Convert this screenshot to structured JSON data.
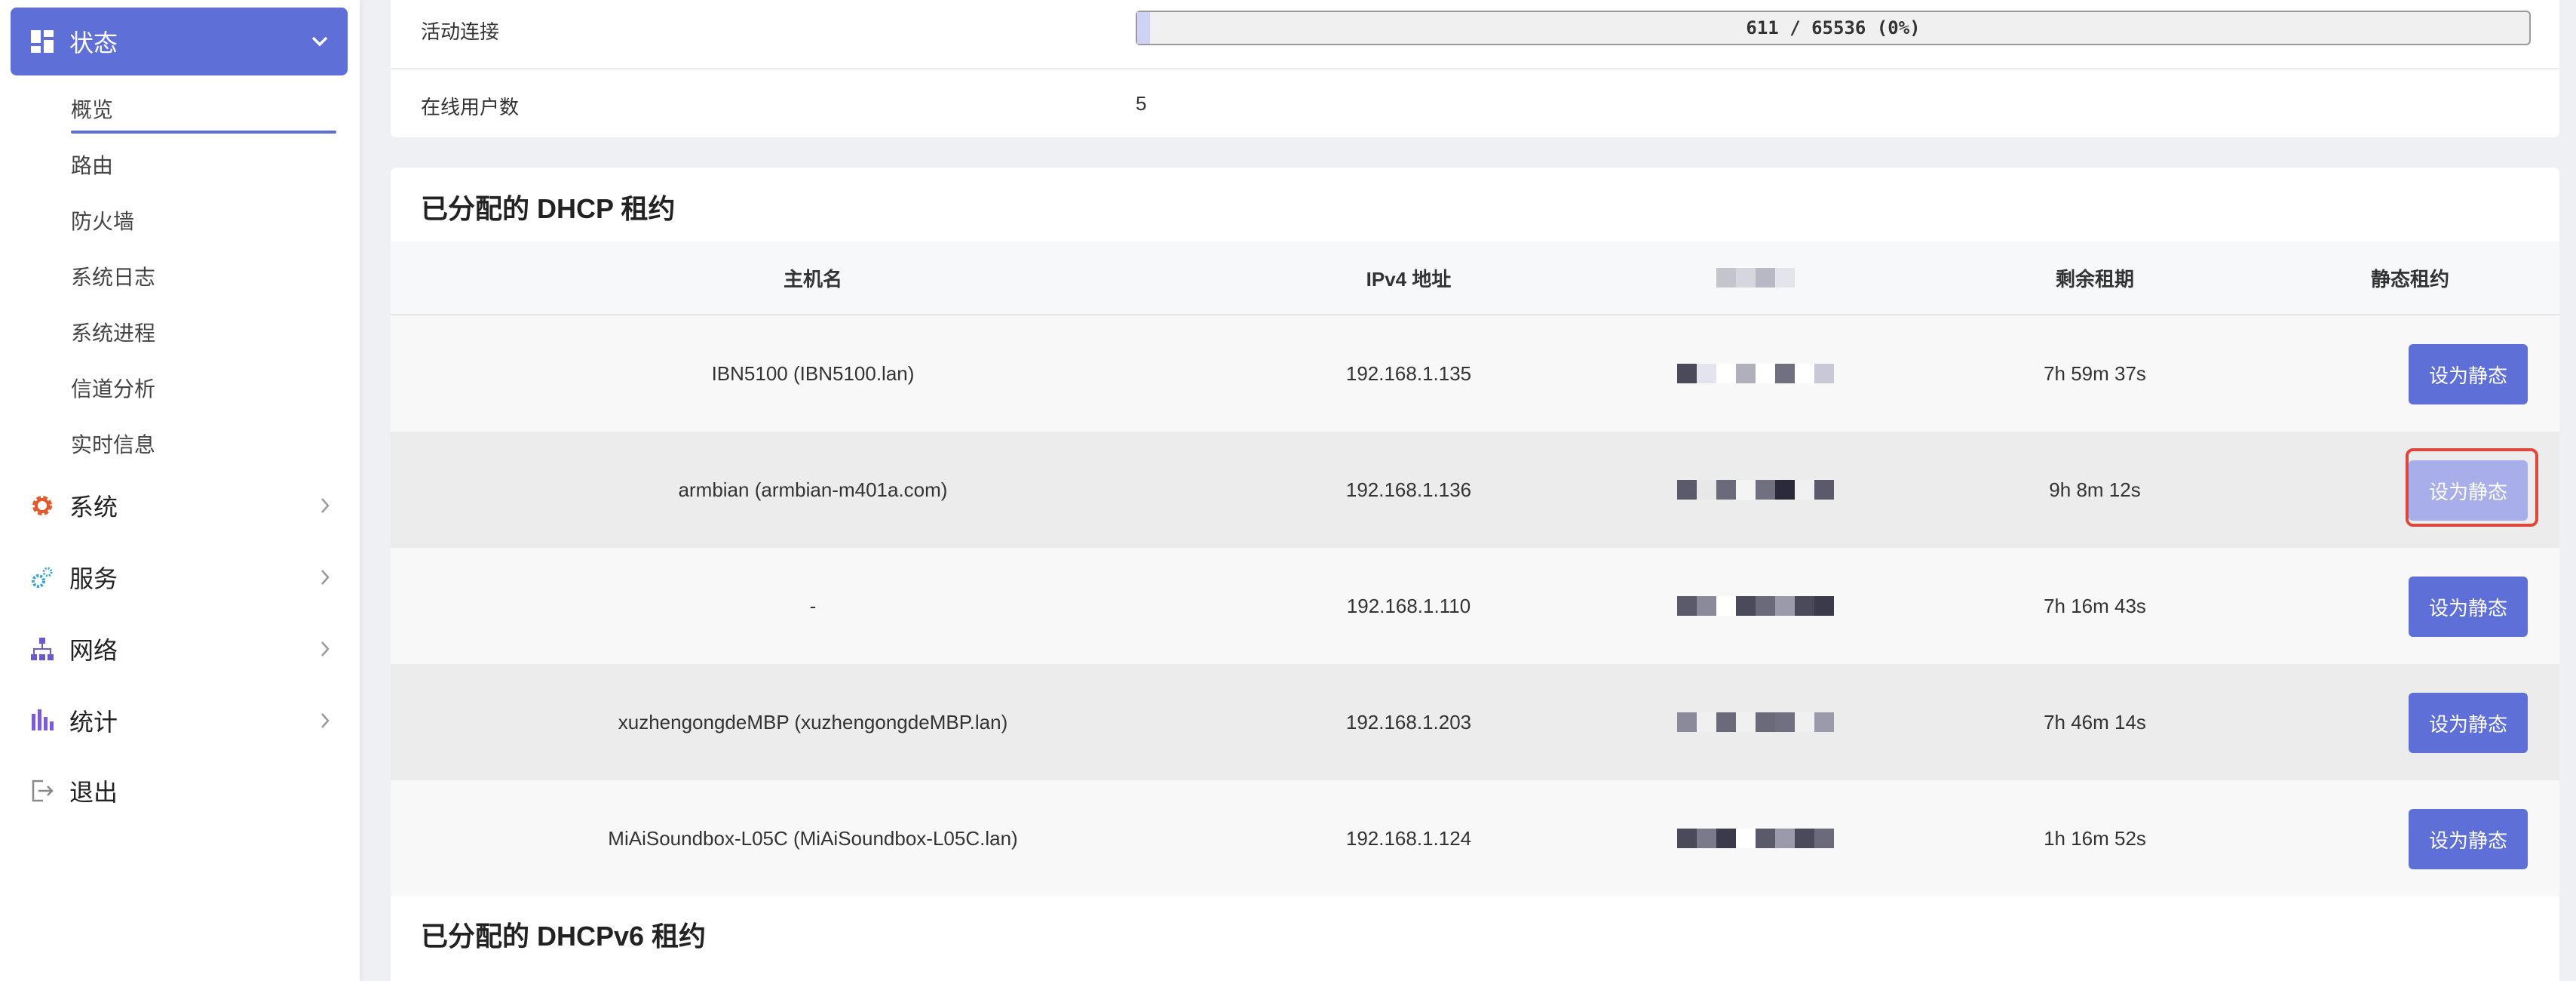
{
  "sidebar": {
    "active": {
      "label": "状态"
    },
    "sub_items": [
      {
        "label": "概览"
      },
      {
        "label": "路由"
      },
      {
        "label": "防火墙"
      },
      {
        "label": "系统日志"
      },
      {
        "label": "系统进程"
      },
      {
        "label": "信道分析"
      },
      {
        "label": "实时信息"
      }
    ],
    "items": [
      {
        "label": "系统",
        "icon": "gear-icon",
        "color": "#e05a2b"
      },
      {
        "label": "服务",
        "icon": "services-icon",
        "color": "#3ba0d8"
      },
      {
        "label": "网络",
        "icon": "network-icon",
        "color": "#6a5acd"
      },
      {
        "label": "统计",
        "icon": "stats-icon",
        "color": "#7b5bd6"
      },
      {
        "label": "退出",
        "icon": "logout-icon",
        "color": "#888888"
      }
    ]
  },
  "overview": {
    "active_connections": {
      "label": "活动连接",
      "value": "611 / 65536 (0%)",
      "fill_fraction": 0.0093
    },
    "online_users": {
      "label": "在线用户数",
      "value": "5"
    }
  },
  "dhcp": {
    "title": "已分配的 DHCP 租约",
    "headers": {
      "host": "主机名",
      "ip": "IPv4 地址",
      "remaining": "剩余租期",
      "static": "静态租约"
    },
    "rows": [
      {
        "host": "IBN5100 (IBN5100.lan)",
        "ip": "192.168.1.135",
        "remaining": "7h 59m 37s",
        "button": "设为静态",
        "disabled": false
      },
      {
        "host": "armbian (armbian-m401a.com)",
        "ip": "192.168.1.136",
        "remaining": "9h 8m 12s",
        "button": "设为静态",
        "disabled": true
      },
      {
        "host": "-",
        "ip": "192.168.1.110",
        "remaining": "7h 16m 43s",
        "button": "设为静态",
        "disabled": false
      },
      {
        "host": "xuzhengongdeMBP (xuzhengongdeMBP.lan)",
        "ip": "192.168.1.203",
        "remaining": "7h 46m 14s",
        "button": "设为静态",
        "disabled": false
      },
      {
        "host": "MiAiSoundbox-L05C (MiAiSoundbox-L05C.lan)",
        "ip": "192.168.1.124",
        "remaining": "1h 16m 52s",
        "button": "设为静态",
        "disabled": false
      }
    ]
  },
  "dhcpv6": {
    "title": "已分配的 DHCPv6 租约"
  },
  "colors": {
    "accent": "#5e6fd8",
    "highlight": "#e0473a"
  }
}
